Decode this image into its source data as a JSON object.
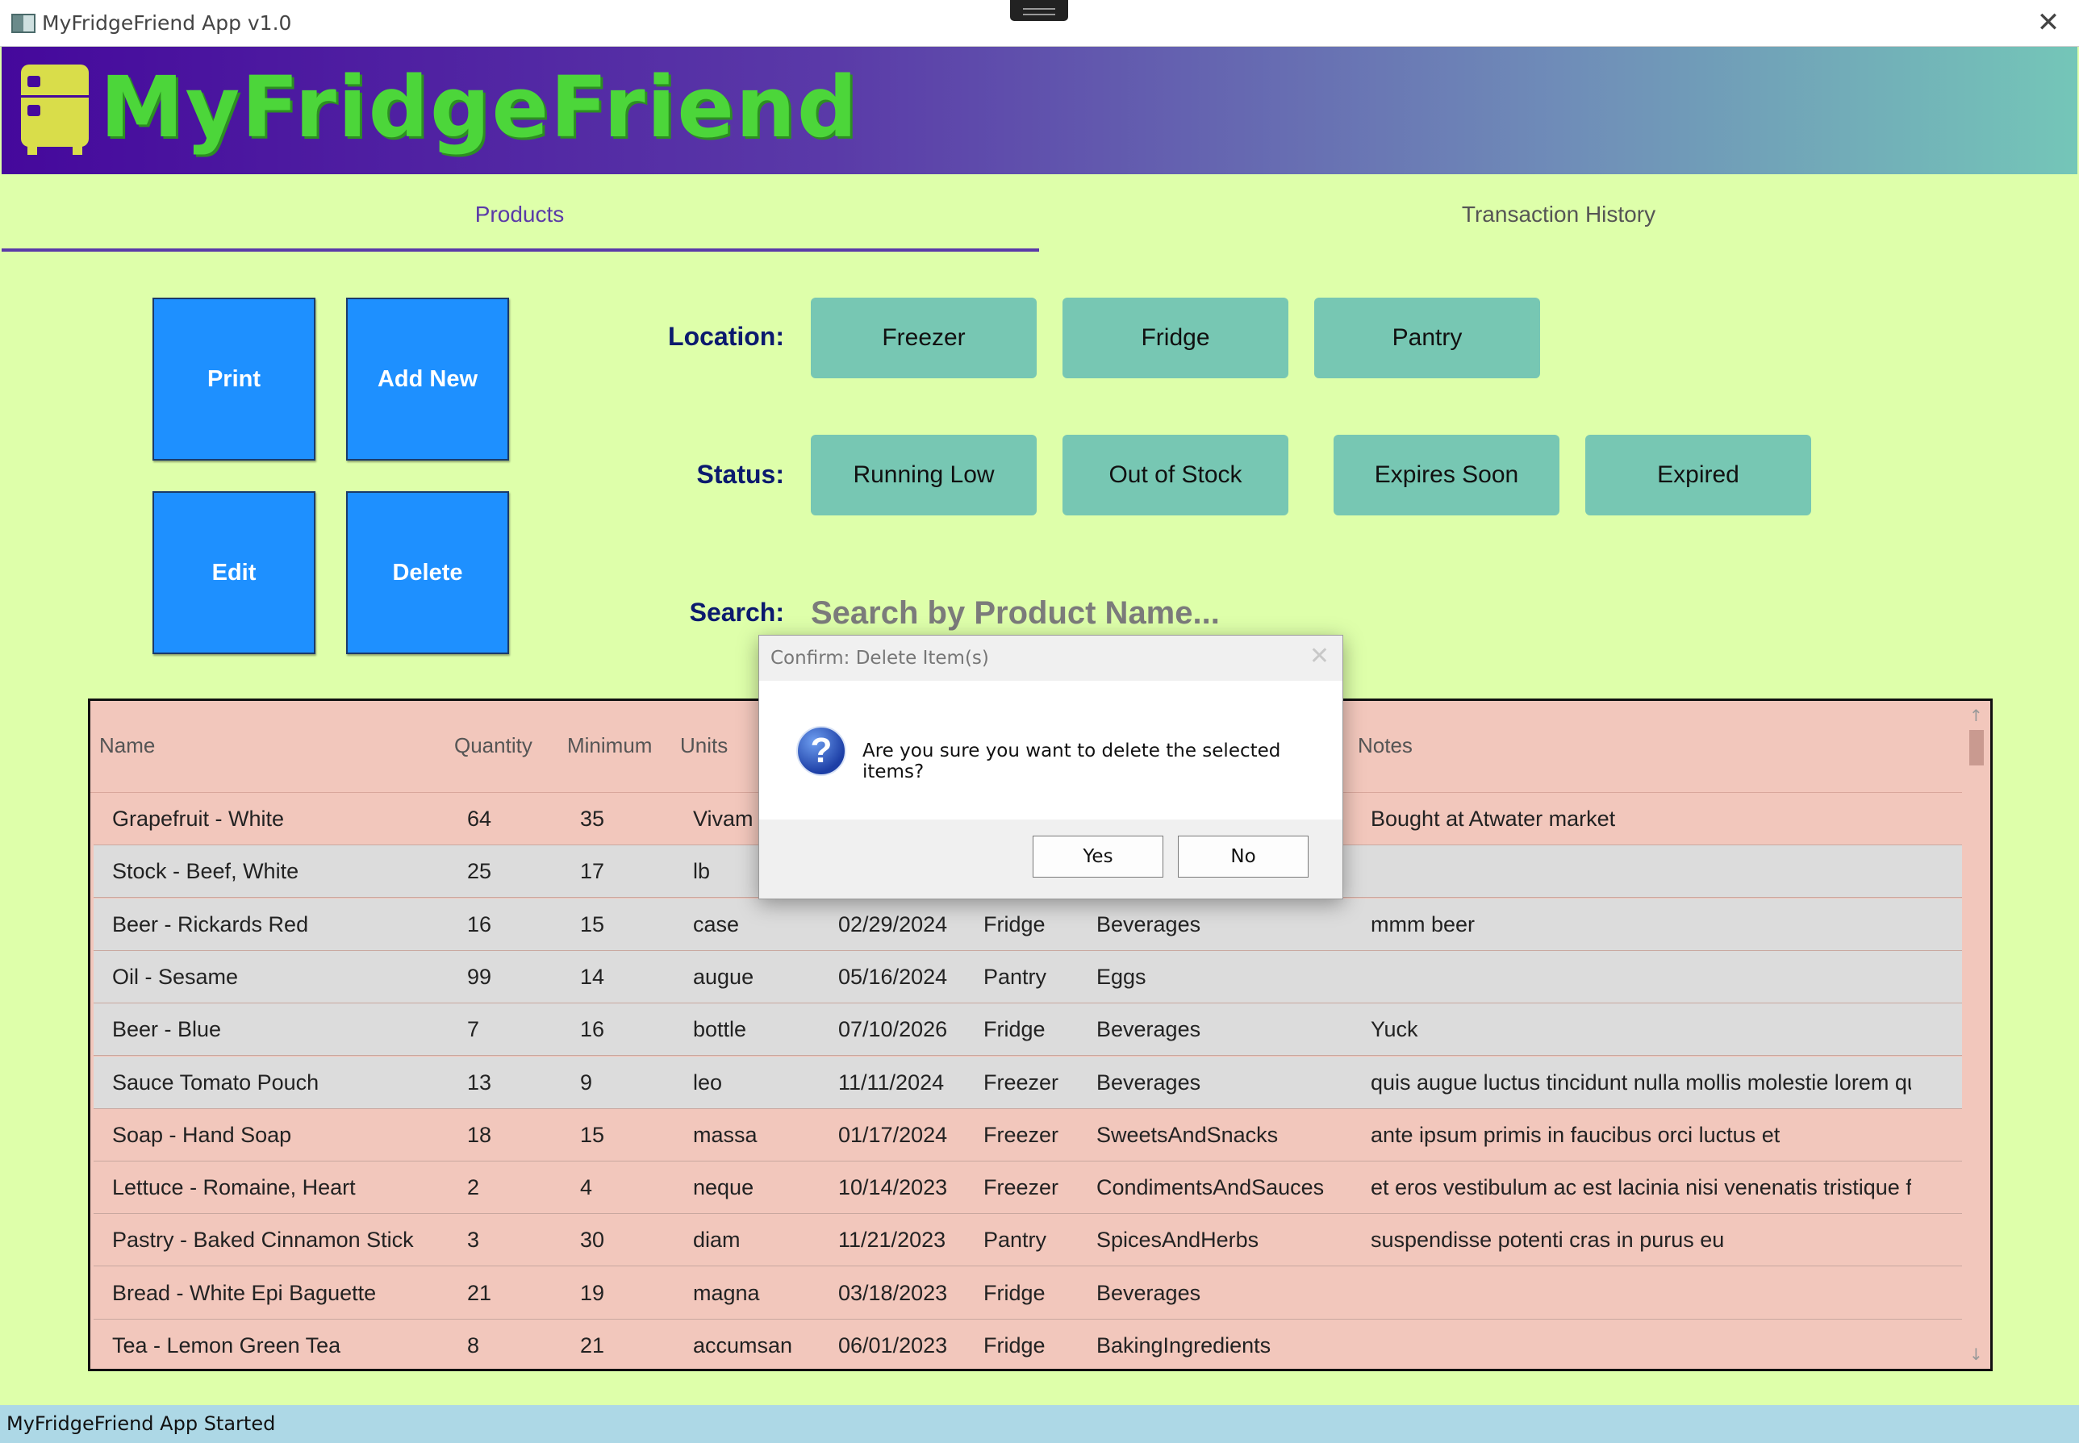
{
  "window": {
    "title": "MyFridgeFriend App v1.0",
    "close_glyph": "✕"
  },
  "banner": {
    "logo_text": "MyFridgeFriend",
    "logo_icon": "fridge-icon"
  },
  "tabs": [
    {
      "label": "Products",
      "active": true
    },
    {
      "label": "Transaction History",
      "active": false
    }
  ],
  "actions": {
    "print": "Print",
    "add_new": "Add New",
    "edit": "Edit",
    "delete": "Delete"
  },
  "filters": {
    "location_label": "Location:",
    "locations": [
      "Freezer",
      "Fridge",
      "Pantry"
    ],
    "status_label": "Status:",
    "statuses": [
      "Running Low",
      "Out of Stock",
      "Expires Soon",
      "Expired"
    ],
    "search_label": "Search:",
    "search_placeholder": "Search by Product Name..."
  },
  "table": {
    "columns": [
      "Name",
      "Quantity",
      "Minimum",
      "Units",
      "Notes"
    ],
    "rows": [
      {
        "name": "Grapefruit - White",
        "quantity": "64",
        "minimum": "35",
        "units": "Vivam",
        "date": "",
        "location": "",
        "category": "",
        "notes": "Bought at Atwater market",
        "tint": "pink"
      },
      {
        "name": "Stock - Beef, White",
        "quantity": "25",
        "minimum": "17",
        "units": "lb",
        "date": "",
        "location": "",
        "category": "",
        "notes": "",
        "tint": "grey"
      },
      {
        "name": "Beer - Rickards Red",
        "quantity": "16",
        "minimum": "15",
        "units": "case",
        "date": "02/29/2024",
        "location": "Fridge",
        "category": "Beverages",
        "notes": "mmm beer",
        "tint": "grey"
      },
      {
        "name": "Oil - Sesame",
        "quantity": "99",
        "minimum": "14",
        "units": "augue",
        "date": "05/16/2024",
        "location": "Pantry",
        "category": "Eggs",
        "notes": "",
        "tint": "grey"
      },
      {
        "name": "Beer - Blue",
        "quantity": "7",
        "minimum": "16",
        "units": "bottle",
        "date": "07/10/2026",
        "location": "Fridge",
        "category": "Beverages",
        "notes": "Yuck",
        "tint": "grey"
      },
      {
        "name": "Sauce Tomato Pouch",
        "quantity": "13",
        "minimum": "9",
        "units": "leo",
        "date": "11/11/2024",
        "location": "Freezer",
        "category": "Beverages",
        "notes": "quis augue luctus tincidunt nulla mollis molestie lorem qu",
        "tint": "grey"
      },
      {
        "name": "Soap - Hand Soap",
        "quantity": "18",
        "minimum": "15",
        "units": "massa",
        "date": "01/17/2024",
        "location": "Freezer",
        "category": "SweetsAndSnacks",
        "notes": "ante ipsum primis in faucibus orci luctus et",
        "tint": "pink"
      },
      {
        "name": "Lettuce - Romaine, Heart",
        "quantity": "2",
        "minimum": "4",
        "units": "neque",
        "date": "10/14/2023",
        "location": "Freezer",
        "category": "CondimentsAndSauces",
        "notes": "et eros vestibulum ac est lacinia nisi venenatis tristique fu",
        "tint": "pink"
      },
      {
        "name": "Pastry - Baked Cinnamon Stick",
        "quantity": "3",
        "minimum": "30",
        "units": "diam",
        "date": "11/21/2023",
        "location": "Pantry",
        "category": "SpicesAndHerbs",
        "notes": "suspendisse potenti cras in purus eu",
        "tint": "pink"
      },
      {
        "name": "Bread - White Epi Baguette",
        "quantity": "21",
        "minimum": "19",
        "units": "magna",
        "date": "03/18/2023",
        "location": "Fridge",
        "category": "Beverages",
        "notes": "",
        "tint": "pink"
      },
      {
        "name": "Tea - Lemon Green Tea",
        "quantity": "8",
        "minimum": "21",
        "units": "accumsan",
        "date": "06/01/2023",
        "location": "Fridge",
        "category": "BakingIngredients",
        "notes": "",
        "tint": "pink"
      }
    ]
  },
  "dialog": {
    "title": "Confirm: Delete Item(s)",
    "message": "Are you sure you want to delete the selected items?",
    "yes": "Yes",
    "no": "No",
    "icon": "question-icon"
  },
  "status_bar": {
    "text": "MyFridgeFriend App Started"
  },
  "colors": {
    "background": "#deffaa",
    "action_button": "#1e90ff",
    "filter_button": "#77c7b3",
    "row_pink": "#f2c7bc",
    "row_grey": "#dcdcdc",
    "tab_accent": "#5a3aa8",
    "logo_green": "#4cd63a"
  }
}
